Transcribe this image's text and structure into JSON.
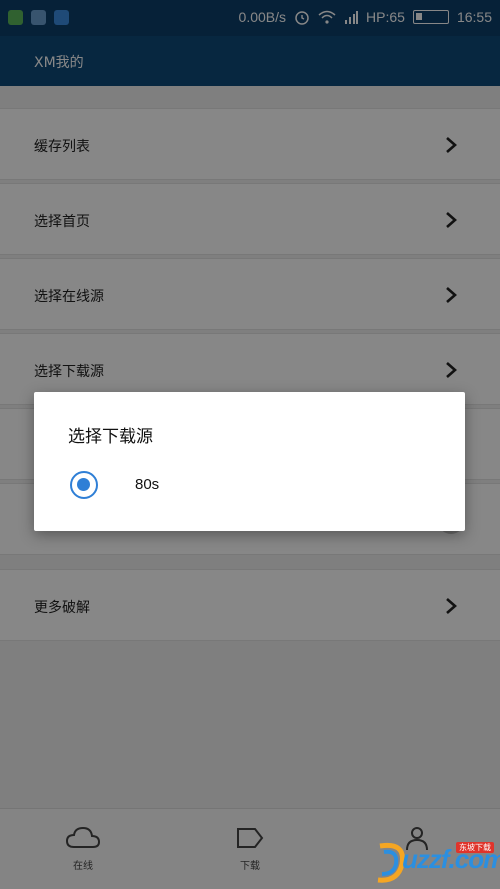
{
  "status_bar": {
    "net_speed": "0.00B/s",
    "carrier": "HP:65",
    "time": "16:55",
    "icons": [
      "notification-green-icon",
      "gallery-icon",
      "bell-icon",
      "alarm-icon",
      "wifi-icon",
      "signal-icon",
      "battery-icon"
    ],
    "battery_level": 0.2
  },
  "app_bar": {
    "title": "XM我的"
  },
  "menu": {
    "items": [
      {
        "label": "缓存列表",
        "control": "chevron"
      },
      {
        "label": "选择首页",
        "control": "chevron"
      },
      {
        "label": "选择在线源",
        "control": "chevron"
      },
      {
        "label": "选择下载源",
        "control": "chevron"
      },
      {
        "label": "",
        "control": "toggle-on"
      },
      {
        "label": "",
        "control": "toggle-off"
      },
      {
        "label": "更多破解",
        "control": "chevron"
      }
    ]
  },
  "dialog": {
    "title": "选择下载源",
    "options": [
      {
        "label": "80s",
        "selected": true
      }
    ]
  },
  "bottom_nav": {
    "items": [
      {
        "label": "在线",
        "icon": "cloud-icon"
      },
      {
        "label": "下载",
        "icon": "tag-icon"
      },
      {
        "label": "",
        "icon": "person-icon"
      }
    ]
  },
  "watermark": {
    "text": "uzzf.com",
    "tag": "东坡下载"
  },
  "colors": {
    "status_bar": "#0d3f6b",
    "app_bar": "#0f4a7a",
    "accent": "#2f7fd6",
    "dim": "rgba(0,0,0,0.47)"
  }
}
